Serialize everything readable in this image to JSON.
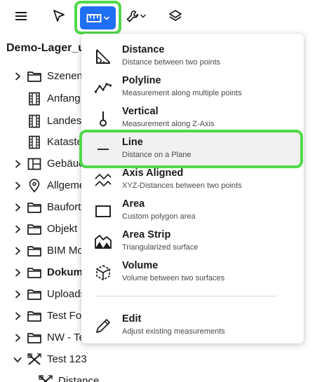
{
  "colors": {
    "accent": "#1f6ff2",
    "highlight": "#4fd94a",
    "text": "#1a1a1a",
    "subtext": "#4a4a4a"
  },
  "toolbar": {
    "icons": [
      "hamburger-menu-icon",
      "pointer-select-icon",
      "ruler-icon",
      "wrench-icon",
      "layers-icon"
    ]
  },
  "tree": {
    "title": "Demo-Lager_u",
    "items": [
      {
        "label": "Szenen",
        "icon": "folder-icon",
        "chevron": "right",
        "bold": false
      },
      {
        "label": "Anfang",
        "icon": "film-icon",
        "chevron": "none",
        "bold": false
      },
      {
        "label": "Landes",
        "icon": "film-icon",
        "chevron": "none",
        "bold": false
      },
      {
        "label": "Kataste",
        "icon": "film-icon",
        "chevron": "none",
        "bold": false
      },
      {
        "label": "Gebäuc",
        "icon": "floorplan-icon",
        "chevron": "right",
        "bold": false
      },
      {
        "label": "Allgeme",
        "icon": "map-pin-icon",
        "chevron": "right",
        "bold": false
      },
      {
        "label": "Baufort",
        "icon": "folder-icon",
        "chevron": "right",
        "bold": false
      },
      {
        "label": "Objekt",
        "icon": "folder-icon",
        "chevron": "right",
        "bold": false
      },
      {
        "label": "BIM Mo",
        "icon": "folder-icon",
        "chevron": "right",
        "bold": false
      },
      {
        "label": "Dokume",
        "icon": "folder-icon",
        "chevron": "right",
        "bold": true
      },
      {
        "label": "Uploads",
        "icon": "folder-icon",
        "chevron": "right",
        "bold": false
      },
      {
        "label": "Test Fo",
        "icon": "folder-icon",
        "chevron": "right",
        "bold": false
      },
      {
        "label": "NW - Te",
        "icon": "folder-icon",
        "chevron": "right",
        "bold": false
      },
      {
        "label": "Test 123",
        "icon": "measure-tools-icon",
        "chevron": "down",
        "bold": false
      },
      {
        "label": "Distance",
        "icon": "measure-tools-icon",
        "chevron": "none",
        "bold": false
      }
    ]
  },
  "menu": {
    "items": [
      {
        "title": "Distance",
        "subtitle": "Distance between two points",
        "icon": "distance-angle-icon"
      },
      {
        "title": "Polyline",
        "subtitle": "Measurement along multiple points",
        "icon": "polyline-icon"
      },
      {
        "title": "Vertical",
        "subtitle": "Measurement along Z-Axis",
        "icon": "vertical-icon"
      },
      {
        "title": "Line",
        "subtitle": "Distance on a Plane",
        "icon": "line-icon"
      },
      {
        "title": "Axis Aligned",
        "subtitle": "XYZ-Distances between two points",
        "icon": "axis-aligned-icon"
      },
      {
        "title": "Area",
        "subtitle": "Custom polygon area",
        "icon": "area-icon"
      },
      {
        "title": "Area Strip",
        "subtitle": "Triangularized surface",
        "icon": "area-strip-icon"
      },
      {
        "title": "Volume",
        "subtitle": "Volume between two surfaces",
        "icon": "volume-cube-icon"
      },
      {
        "title": "Edit",
        "subtitle": "Adjust existing measurements",
        "icon": "pencil-icon"
      }
    ]
  }
}
